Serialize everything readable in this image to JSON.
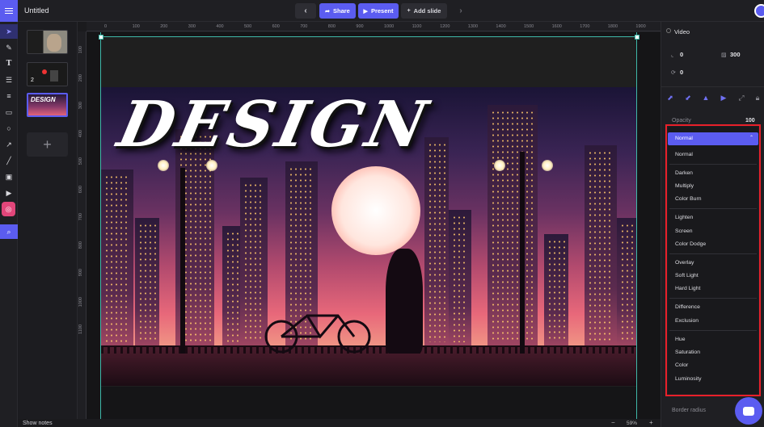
{
  "header": {
    "title": "Untitled",
    "prev_label": "‹",
    "share_label": "Share",
    "present_label": "Present",
    "add_slide_label": "Add slide",
    "next_label": "›"
  },
  "slides": {
    "thumb2_number": "2",
    "thumb3_text": "DESIGN",
    "add_label": "+"
  },
  "ruler": {
    "x_ticks": [
      "0",
      "100",
      "200",
      "300",
      "400",
      "500",
      "600",
      "700",
      "800",
      "900",
      "1000",
      "1100",
      "1200",
      "1300",
      "1400",
      "1500",
      "1600",
      "1700",
      "1800",
      "1900"
    ],
    "y_ticks": [
      "100",
      "200",
      "300",
      "400",
      "500",
      "600",
      "700",
      "800",
      "900",
      "1000",
      "1100"
    ]
  },
  "canvas": {
    "headline": "DESIGN"
  },
  "panel": {
    "title": "Video",
    "x_value": "0",
    "width_value": "300",
    "rotation_value": "0",
    "opacity_label": "Opacity",
    "opacity_value": "100",
    "border_radius_label": "Border radius"
  },
  "blend_dropdown": {
    "selected": "Normal",
    "groups": [
      [
        "Normal"
      ],
      [
        "Darken",
        "Multiply",
        "Color Burn"
      ],
      [
        "Lighten",
        "Screen",
        "Color Dodge"
      ],
      [
        "Overlay",
        "Soft Light",
        "Hard Light"
      ],
      [
        "Difference",
        "Exclusion"
      ],
      [
        "Hue",
        "Saturation",
        "Color",
        "Luminosity"
      ]
    ]
  },
  "footer": {
    "show_notes": "Show notes",
    "zoom": "59%",
    "zoom_minus": "−",
    "zoom_plus": "+"
  },
  "colors": {
    "accent": "#5b5cf0",
    "highlight": "#e8202a",
    "selection": "#3fb8a9"
  }
}
